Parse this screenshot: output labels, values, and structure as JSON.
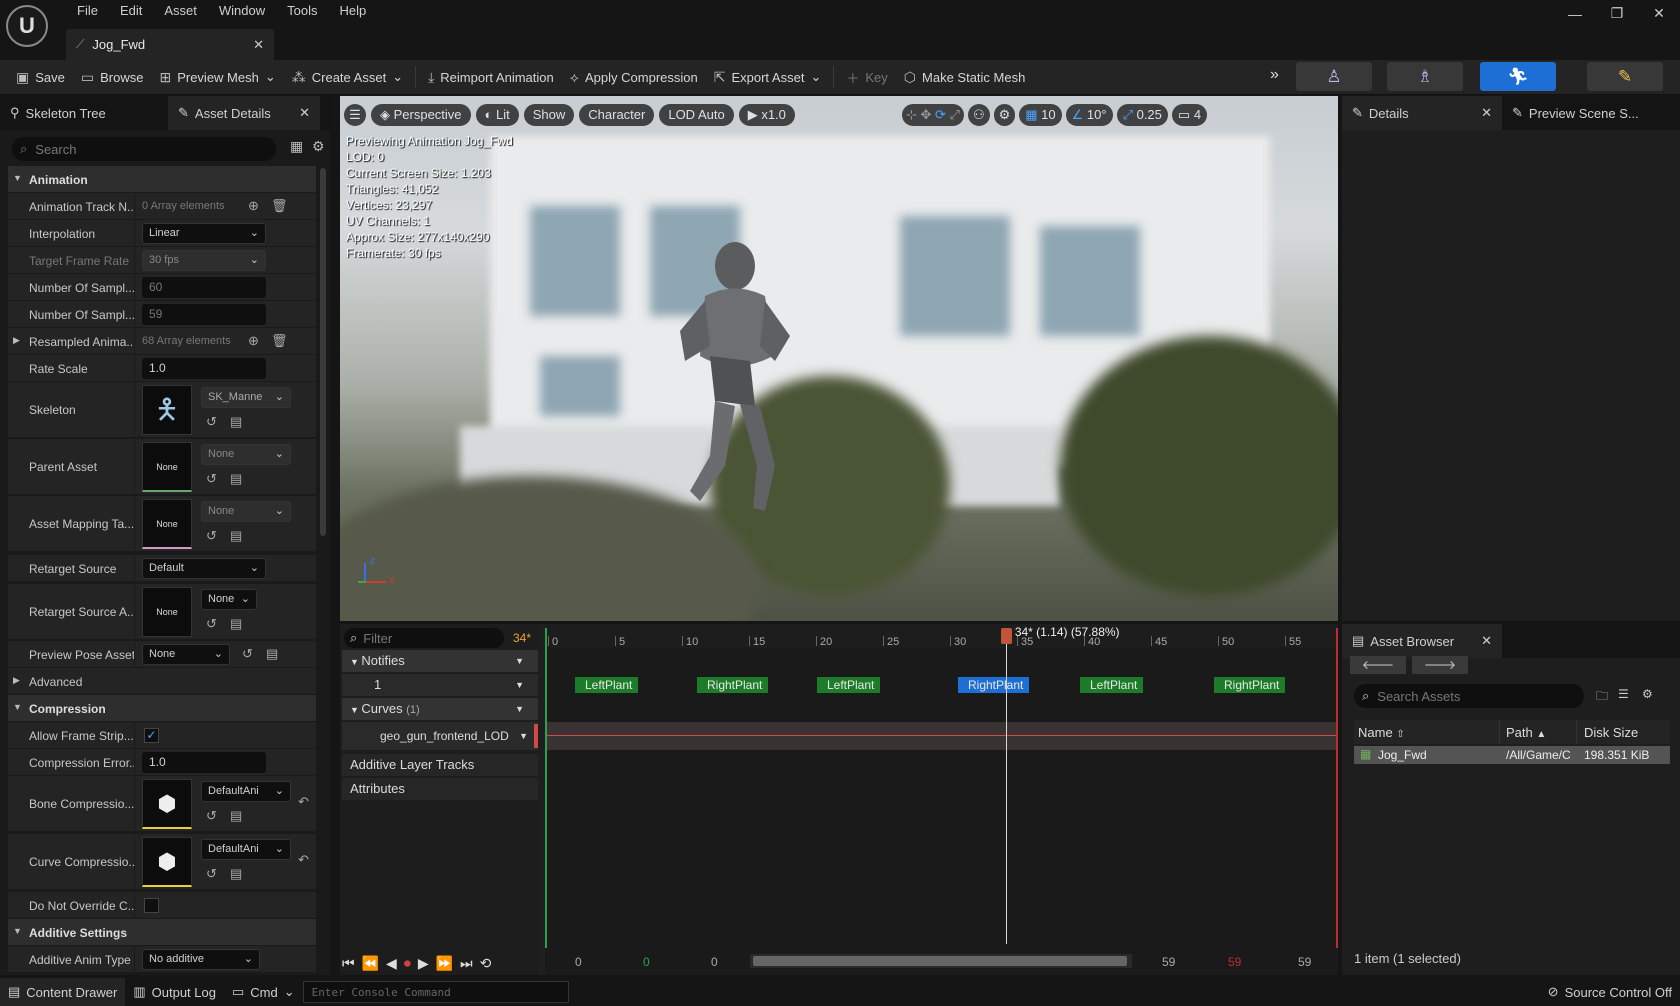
{
  "app": {
    "logo": "U",
    "menu": [
      "File",
      "Edit",
      "Asset",
      "Window",
      "Tools",
      "Help"
    ],
    "doc_tab": "Jog_Fwd"
  },
  "toolbar": {
    "save": "Save",
    "browse": "Browse",
    "preview_mesh": "Preview Mesh",
    "create_asset": "Create Asset",
    "reimport": "Reimport Animation",
    "apply_compression": "Apply Compression",
    "export_asset": "Export Asset",
    "key": "Key",
    "make_static_mesh": "Make Static Mesh"
  },
  "left_panel": {
    "tabs": [
      "Skeleton Tree",
      "Asset Details"
    ],
    "search_placeholder": "Search",
    "rows": {
      "animation": "Animation",
      "track_names": "Animation Track N...",
      "track_names_val": "0 Array elements",
      "interpolation": "Interpolation",
      "interpolation_val": "Linear",
      "target_frame_rate": "Target Frame Rate",
      "target_frame_rate_val": "30 fps",
      "num_samples1": "Number Of Sampl...",
      "num_samples1_val": "60",
      "num_samples2": "Number Of Sampl...",
      "num_samples2_val": "59",
      "resampled": "Resampled Anima...",
      "resampled_val": "68 Array elements",
      "rate_scale": "Rate Scale",
      "rate_scale_val": "1.0",
      "skeleton": "Skeleton",
      "skeleton_val": "SK_Manne",
      "parent_asset": "Parent Asset",
      "parent_asset_val": "None",
      "parent_thumb": "None",
      "asset_mapping": "Asset Mapping Ta...",
      "asset_mapping_val": "None",
      "asset_mapping_thumb": "None",
      "retarget_source": "Retarget Source",
      "retarget_source_val": "Default",
      "retarget_source_a": "Retarget Source A...",
      "retarget_source_a_val": "None",
      "retarget_source_a_thumb": "None",
      "preview_pose": "Preview Pose Asset",
      "preview_pose_val": "None",
      "advanced": "Advanced",
      "compression": "Compression",
      "allow_frame_strip": "Allow Frame Strip...",
      "compression_error": "Compression Error...",
      "compression_error_val": "1.0",
      "bone_compression": "Bone Compressio...",
      "bone_compression_val": "DefaultAni",
      "curve_compression": "Curve Compressio...",
      "curve_compression_val": "DefaultAni",
      "do_not_override": "Do Not Override C...",
      "additive_settings": "Additive Settings",
      "additive_anim_type": "Additive Anim Type",
      "additive_anim_type_val": "No additive"
    }
  },
  "viewport": {
    "buttons": [
      "Perspective",
      "Lit",
      "Show",
      "Character",
      "LOD Auto",
      "x1.0"
    ],
    "right_values": [
      "10",
      "10°",
      "0.25",
      "4"
    ],
    "info": [
      "Previewing Animation Jog_Fwd",
      "LOD: 0",
      "Current Screen Size: 1.203",
      "Triangles: 41,052",
      "Vertices: 23,297",
      "UV Channels: 1",
      "Approx Size: 277x140x290",
      "Framerate: 30 fps"
    ],
    "axis_x": "x",
    "axis_z": "z"
  },
  "sequencer": {
    "filter_placeholder": "Filter",
    "current_frame": "34*",
    "playhead_label": "34* (1.14) (57.88%)",
    "ticks": [
      "0",
      "5",
      "10",
      "15",
      "20",
      "25",
      "30",
      "35",
      "40",
      "45",
      "50",
      "55"
    ],
    "tracks": {
      "notifies": "Notifies",
      "notify_row": "1",
      "curves": "Curves",
      "curves_count": "(1)",
      "curve_name": "geo_gun_frontend_LOD",
      "additive": "Additive Layer Tracks",
      "attributes": "Attributes"
    },
    "notifies": [
      "LeftPlant",
      "RightPlant",
      "LeftPlant",
      "RightPlant",
      "LeftPlant",
      "RightPlant"
    ],
    "transport_values": [
      "0",
      "0",
      "0",
      "59",
      "59",
      "59"
    ],
    "playhead_fraction": 0.5788
  },
  "details": {
    "tabs": [
      "Details",
      "Preview Scene S..."
    ]
  },
  "asset_browser": {
    "tab": "Asset Browser",
    "search_placeholder": "Search Assets",
    "columns": [
      "Name",
      "Path",
      "Disk Size"
    ],
    "rows": [
      {
        "name": "Jog_Fwd",
        "path": "/All/Game/C",
        "size": "198.351 KiB"
      }
    ],
    "footer": "1 item (1 selected)"
  },
  "statusbar": {
    "content_drawer": "Content Drawer",
    "output_log": "Output Log",
    "cmd": "Cmd",
    "console_placeholder": "Enter Console Command",
    "source_control": "Source Control Off"
  },
  "colors": {
    "accent": "#1d6fd6",
    "notify_green": "#1c7c2a",
    "playhead": "#c0553a"
  }
}
